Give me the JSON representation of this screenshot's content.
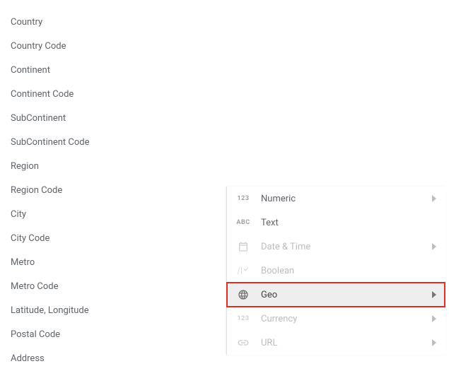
{
  "geo_submenu": {
    "items": [
      "Country",
      "Country Code",
      "Continent",
      "Continent Code",
      "SubContinent",
      "SubContinent Code",
      "Region",
      "Region Code",
      "City",
      "City Code",
      "Metro",
      "Metro Code",
      "Latitude, Longitude",
      "Postal Code",
      "Address"
    ]
  },
  "type_menu": {
    "items": [
      {
        "key": "numeric",
        "label": "Numeric",
        "has_submenu": true,
        "emphasis": "dark",
        "iconKey": "123"
      },
      {
        "key": "text",
        "label": "Text",
        "has_submenu": false,
        "emphasis": "dark",
        "iconKey": "ABC"
      },
      {
        "key": "datetime",
        "label": "Date & Time",
        "has_submenu": true,
        "emphasis": "light",
        "iconKey": "calendar"
      },
      {
        "key": "boolean",
        "label": "Boolean",
        "has_submenu": false,
        "emphasis": "light",
        "iconKey": "boolean"
      },
      {
        "key": "geo",
        "label": "Geo",
        "has_submenu": true,
        "emphasis": "dark",
        "iconKey": "globe",
        "hovered": true,
        "highlighted": true
      },
      {
        "key": "currency",
        "label": "Currency",
        "has_submenu": true,
        "emphasis": "light",
        "iconKey": "123"
      },
      {
        "key": "url",
        "label": "URL",
        "has_submenu": true,
        "emphasis": "light",
        "iconKey": "link"
      }
    ]
  },
  "colors": {
    "highlight_border": "#d93025",
    "hover_bg": "#eeeeee",
    "text_primary": "#5f6368",
    "text_muted": "#bdbdbd"
  }
}
